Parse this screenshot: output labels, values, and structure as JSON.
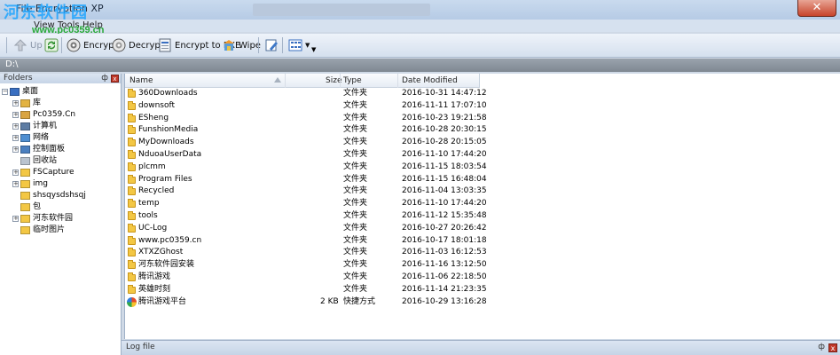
{
  "window": {
    "title": "File Encryption XP",
    "close_glyph": "✕",
    "watermark_text": "河东软件园",
    "watermark_url": "www.pc0359.cn"
  },
  "menu": {
    "items": [
      "View",
      "Tools",
      "Help"
    ]
  },
  "toolbar": {
    "up_label": "Up",
    "encrypt_label": "Encrypt",
    "decrypt_label": "Decrypt",
    "encrypt_exe_label": "Encrypt to EXE",
    "wipe_label": "Wipe"
  },
  "address": {
    "path": "D:\\"
  },
  "folders_pane": {
    "title": "Folders",
    "pin": "ф",
    "close": "x",
    "tree": [
      {
        "label": "桌面",
        "level": 0,
        "expand": "−",
        "icon": "desktop-icon"
      },
      {
        "label": "库",
        "level": 1,
        "expand": "+",
        "icon": "library-icon"
      },
      {
        "label": "Pc0359.Cn",
        "level": 1,
        "expand": "+",
        "icon": "user-icon"
      },
      {
        "label": "计算机",
        "level": 1,
        "expand": "+",
        "icon": "computer-icon"
      },
      {
        "label": "网络",
        "level": 1,
        "expand": "+",
        "icon": "network-icon"
      },
      {
        "label": "控制面板",
        "level": 1,
        "expand": "+",
        "icon": "control-panel-icon"
      },
      {
        "label": "回收站",
        "level": 1,
        "expand": "",
        "icon": "recycle-bin-icon"
      },
      {
        "label": "FSCapture",
        "level": 1,
        "expand": "+",
        "icon": "folder-icon"
      },
      {
        "label": "img",
        "level": 1,
        "expand": "+",
        "icon": "folder-icon"
      },
      {
        "label": "shsqysdshsqj",
        "level": 1,
        "expand": "",
        "icon": "folder-icon"
      },
      {
        "label": "包",
        "level": 1,
        "expand": "",
        "icon": "folder-icon"
      },
      {
        "label": "河东软件园",
        "level": 1,
        "expand": "+",
        "icon": "folder-icon"
      },
      {
        "label": "临时图片",
        "level": 1,
        "expand": "",
        "icon": "folder-icon"
      }
    ]
  },
  "file_list": {
    "columns": {
      "name": "Name",
      "size": "Size",
      "type": "Type",
      "date": "Date Modified"
    },
    "rows": [
      {
        "name": "360Downloads",
        "size": "",
        "type": "文件夹",
        "date": "2016-10-31 14:47:12",
        "icon": "folder-icon"
      },
      {
        "name": "downsoft",
        "size": "",
        "type": "文件夹",
        "date": "2016-11-11 17:07:10",
        "icon": "folder-icon"
      },
      {
        "name": "ESheng",
        "size": "",
        "type": "文件夹",
        "date": "2016-10-23 19:21:58",
        "icon": "folder-icon"
      },
      {
        "name": "FunshionMedia",
        "size": "",
        "type": "文件夹",
        "date": "2016-10-28 20:30:15",
        "icon": "folder-icon"
      },
      {
        "name": "MyDownloads",
        "size": "",
        "type": "文件夹",
        "date": "2016-10-28 20:15:05",
        "icon": "folder-icon"
      },
      {
        "name": "NduoaUserData",
        "size": "",
        "type": "文件夹",
        "date": "2016-11-10 17:44:20",
        "icon": "folder-icon"
      },
      {
        "name": "plcmm",
        "size": "",
        "type": "文件夹",
        "date": "2016-11-15 18:03:54",
        "icon": "folder-icon"
      },
      {
        "name": "Program Files",
        "size": "",
        "type": "文件夹",
        "date": "2016-11-15 16:48:04",
        "icon": "folder-icon"
      },
      {
        "name": "Recycled",
        "size": "",
        "type": "文件夹",
        "date": "2016-11-04 13:03:35",
        "icon": "folder-icon"
      },
      {
        "name": "temp",
        "size": "",
        "type": "文件夹",
        "date": "2016-11-10 17:44:20",
        "icon": "folder-icon"
      },
      {
        "name": "tools",
        "size": "",
        "type": "文件夹",
        "date": "2016-11-12 15:35:48",
        "icon": "folder-icon"
      },
      {
        "name": "UC-Log",
        "size": "",
        "type": "文件夹",
        "date": "2016-10-27 20:26:42",
        "icon": "folder-icon"
      },
      {
        "name": "www.pc0359.cn",
        "size": "",
        "type": "文件夹",
        "date": "2016-10-17 18:01:18",
        "icon": "folder-icon"
      },
      {
        "name": "XTXZGhost",
        "size": "",
        "type": "文件夹",
        "date": "2016-11-03 16:12:53",
        "icon": "folder-icon"
      },
      {
        "name": "河东软件园安装",
        "size": "",
        "type": "文件夹",
        "date": "2016-11-16 13:12:50",
        "icon": "folder-icon"
      },
      {
        "name": "腾讯游戏",
        "size": "",
        "type": "文件夹",
        "date": "2016-11-06 22:18:50",
        "icon": "folder-icon"
      },
      {
        "name": "英雄时刻",
        "size": "",
        "type": "文件夹",
        "date": "2016-11-14 21:23:35",
        "icon": "folder-icon"
      },
      {
        "name": "腾讯游戏平台",
        "size": "2 KB",
        "type": "快捷方式",
        "date": "2016-10-29 13:16:28",
        "icon": "app-shortcut-icon"
      }
    ]
  },
  "log_pane": {
    "title": "Log file",
    "pin": "ф",
    "close": "x"
  }
}
